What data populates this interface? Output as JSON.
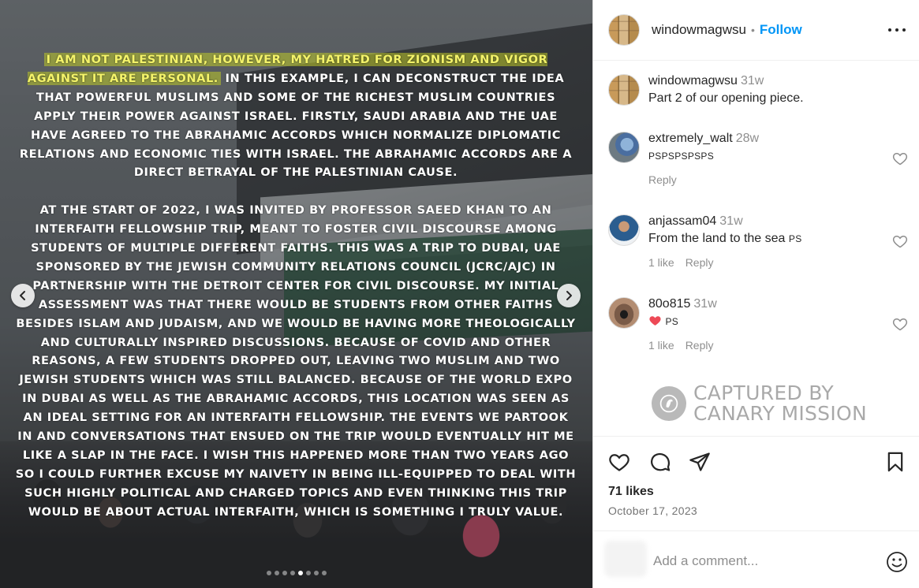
{
  "post": {
    "paragraph1_highlight": "I am not Palestinian, however, my hatred for Zionism and vigor against it are personal.",
    "paragraph1_rest": " In this example, I can deconstruct the idea that powerful Muslims and some of the richest Muslim countries apply their power against Israel. Firstly, Saudi Arabia and the UAE have agreed to the Abrahamic Accords which normalize diplomatic relations and economic ties with Israel. The Abrahamic Accords are a direct betrayal of the Palestinian cause.",
    "paragraph2": "At the start of 2022, I was invited by Professor Saeed Khan to an interfaith fellowship trip, meant to foster civil discourse among students of multiple different faiths. This was a trip to Dubai, UAE sponsored by the Jewish Community Relations Council (JCRC/AJC) in partnership with the Detroit Center for Civil Discourse. My initial assessment was that there would be students from other faiths besides Islam and Judaism, and we would be having more theologically and culturally inspired discussions. Because of Covid and other reasons, a few students dropped out, leaving two Muslim and two Jewish students which was still balanced. Because of the World Expo in Dubai as well as the Abrahamic Accords, this location was seen as an ideal setting for an interfaith fellowship. The events we partook in and conversations that ensued on the trip would eventually hit me like a slap in the face. I wish this happened more than two years ago so I could further excuse my naivety in being ill-equipped to deal with such highly political and charged topics and even thinking this trip would be about actual interfaith, which is something I truly value.",
    "carousel": {
      "total": 8,
      "active_index": 4
    }
  },
  "header": {
    "username": "windowmagwsu",
    "separator": "•",
    "follow_label": "Follow"
  },
  "comments": [
    {
      "user": "windowmagwsu",
      "time": "31w",
      "text": "Part 2 of our opening piece."
    },
    {
      "user": "extremely_walt",
      "time": "28w",
      "text": "PSPSPSPSPS",
      "reply": "Reply"
    },
    {
      "user": "anjassam04",
      "time": "31w",
      "text": "From the land to the sea",
      "suffix": "PS",
      "likes": "1 like",
      "reply": "Reply"
    },
    {
      "user": "80o815",
      "time": "31w",
      "emoji": "❤️",
      "suffix": "PS",
      "likes": "1 like",
      "reply": "Reply"
    }
  ],
  "watermark": {
    "line1": "CAPTURED BY",
    "line2": "CANARY MISSION"
  },
  "stats": {
    "likes": "71 likes",
    "date": "October 17, 2023"
  },
  "add_comment": {
    "placeholder": "Add a comment..."
  },
  "colors": {
    "follow_blue": "#0095f6",
    "highlight": "#f4f36a",
    "heart_red": "#ed4956"
  }
}
